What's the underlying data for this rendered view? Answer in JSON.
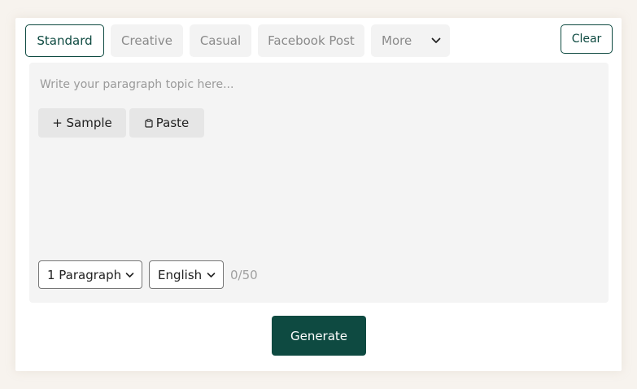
{
  "tabs": [
    {
      "label": "Standard",
      "active": true
    },
    {
      "label": "Creative",
      "active": false
    },
    {
      "label": "Casual",
      "active": false
    },
    {
      "label": "Facebook Post",
      "active": false
    },
    {
      "label": "More",
      "active": false
    }
  ],
  "clear_label": "Clear",
  "editor": {
    "placeholder": "Write your paragraph topic here...",
    "sample_label": "+ Sample",
    "paste_icon": "clipboard-icon",
    "paste_label": "Paste"
  },
  "controls": {
    "paragraphs_value": "1 Paragraph",
    "language_value": "English",
    "counter": "0/50"
  },
  "generate_label": "Generate",
  "colors": {
    "accent": "#0e4a41",
    "editor_bg": "#f4f4f4",
    "tab_bg": "#f3f3f3",
    "page_bg": "#f7f3ee"
  }
}
